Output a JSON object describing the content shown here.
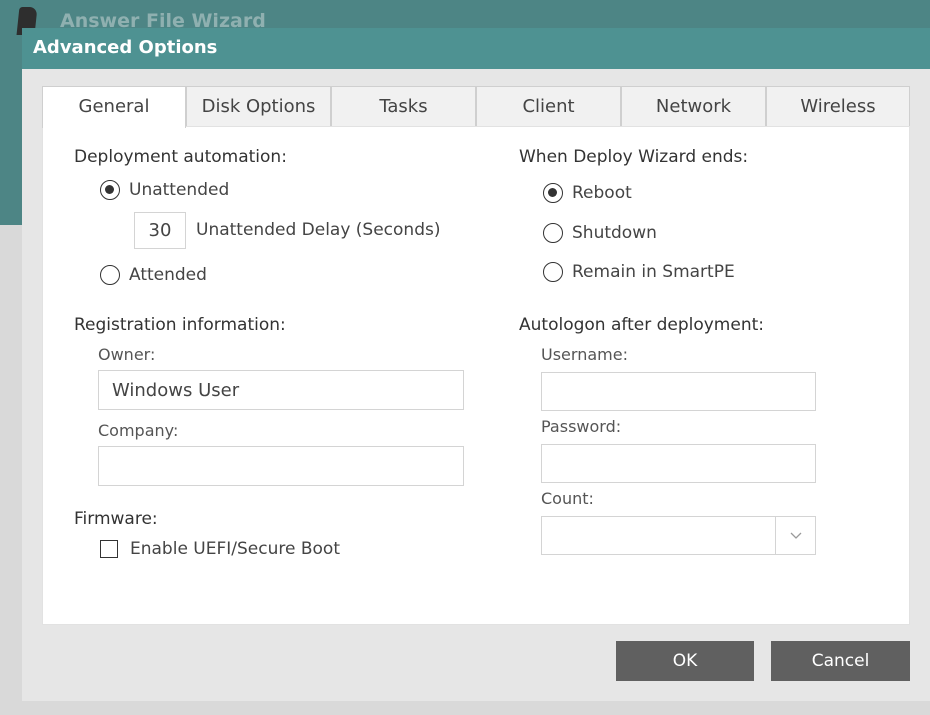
{
  "background_window": {
    "title": "Answer File Wizard"
  },
  "dialog": {
    "title": "Advanced Options"
  },
  "tabs": [
    {
      "label": "General",
      "active": true
    },
    {
      "label": "Disk Options"
    },
    {
      "label": "Tasks"
    },
    {
      "label": "Client"
    },
    {
      "label": "Network"
    },
    {
      "label": "Wireless"
    }
  ],
  "deployment": {
    "heading": "Deployment automation:",
    "unattended_label": "Unattended",
    "delay_value": "30",
    "delay_label": "Unattended Delay (Seconds)",
    "attended_label": "Attended",
    "selected": "Unattended"
  },
  "registration": {
    "heading": "Registration information:",
    "owner_label": "Owner:",
    "owner_value": "Windows User",
    "company_label": "Company:",
    "company_value": ""
  },
  "firmware": {
    "heading": "Firmware:",
    "uefi_label": "Enable UEFI/Secure Boot",
    "uefi_checked": false
  },
  "deploy_end": {
    "heading": "When Deploy Wizard ends:",
    "reboot_label": "Reboot",
    "shutdown_label": "Shutdown",
    "remain_label": "Remain in SmartPE",
    "selected": "Reboot"
  },
  "autologon": {
    "heading": "Autologon after deployment:",
    "username_label": "Username:",
    "username_value": "",
    "password_label": "Password:",
    "password_value": "",
    "count_label": "Count:",
    "count_value": ""
  },
  "buttons": {
    "ok": "OK",
    "cancel": "Cancel"
  },
  "colors": {
    "titlebar": "#4e9292",
    "background_titlebar": "#4d8585",
    "button": "#606060",
    "dialog_body": "#e6e6e6"
  }
}
